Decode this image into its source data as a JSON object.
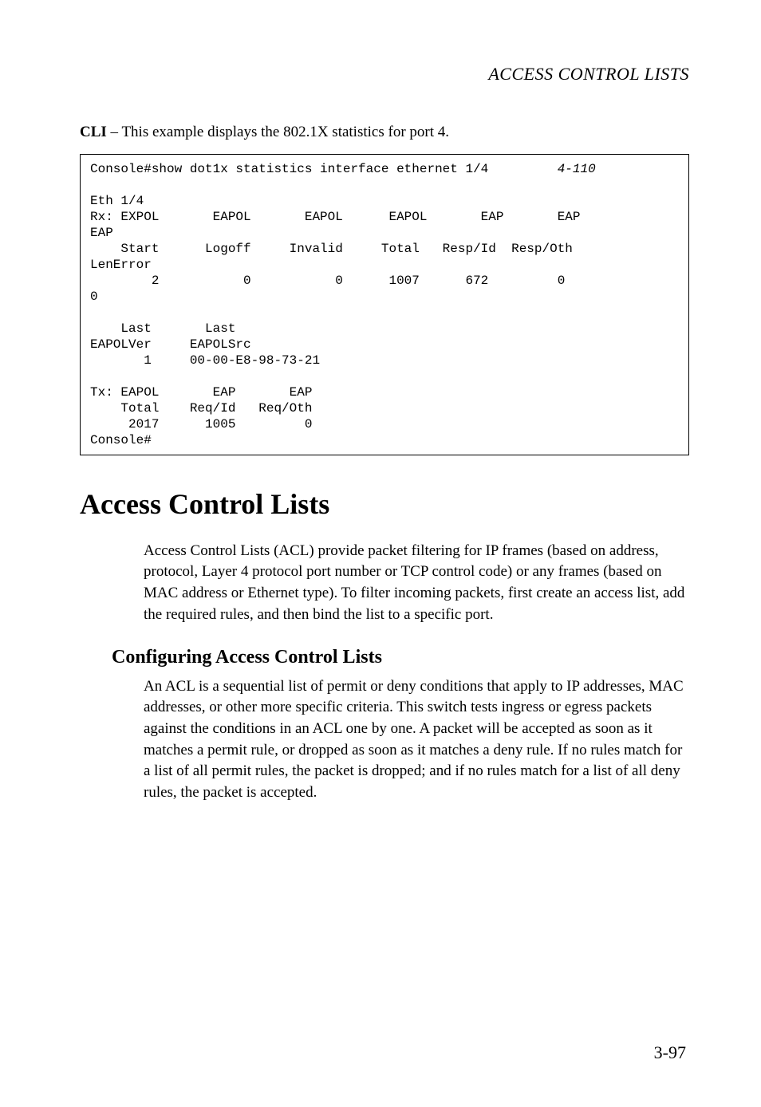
{
  "running_head": "ACCESS CONTROL LISTS",
  "intro_prefix_bold": "CLI",
  "intro_rest": " – This example displays the 802.1X statistics for port 4.",
  "code": {
    "cmd": "Console#show dot1x statistics interface ethernet 1/4",
    "ref": "4-110",
    "l2": "",
    "l3": "Eth 1/4",
    "l4": "Rx: EXPOL       EAPOL       EAPOL      EAPOL       EAP       EAP",
    "l5": "EAP",
    "l6": "    Start      Logoff     Invalid     Total   Resp/Id  Resp/Oth",
    "l7": "LenError",
    "l8": "        2           0           0      1007      672         0",
    "l9": "0",
    "l10": "",
    "l11": "    Last       Last",
    "l12": "EAPOLVer     EAPOLSrc",
    "l13": "       1     00-00-E8-98-73-21",
    "l14": "",
    "l15": "Tx: EAPOL       EAP       EAP",
    "l16": "    Total    Req/Id   Req/Oth",
    "l17": "     2017      1005         0",
    "l18": "Console#"
  },
  "h1": "Access Control Lists",
  "para1": "Access Control Lists (ACL) provide packet filtering for IP frames (based on address, protocol, Layer 4 protocol port number or TCP control code) or any frames (based on MAC address or Ethernet type). To filter incoming packets, first create an access list, add the required rules, and then bind the list to a specific port.",
  "h2": "Configuring Access Control Lists",
  "para2": "An ACL is a sequential list of permit or deny conditions that apply to IP addresses, MAC addresses, or other more specific criteria. This switch tests ingress or egress packets against the conditions in an ACL one by one. A packet will be accepted as soon as it matches a permit rule, or dropped as soon as it matches a deny rule. If no rules match for a list of all permit rules, the packet is dropped; and if no rules match for a list of all deny rules, the packet is accepted.",
  "page_number": "3-97"
}
